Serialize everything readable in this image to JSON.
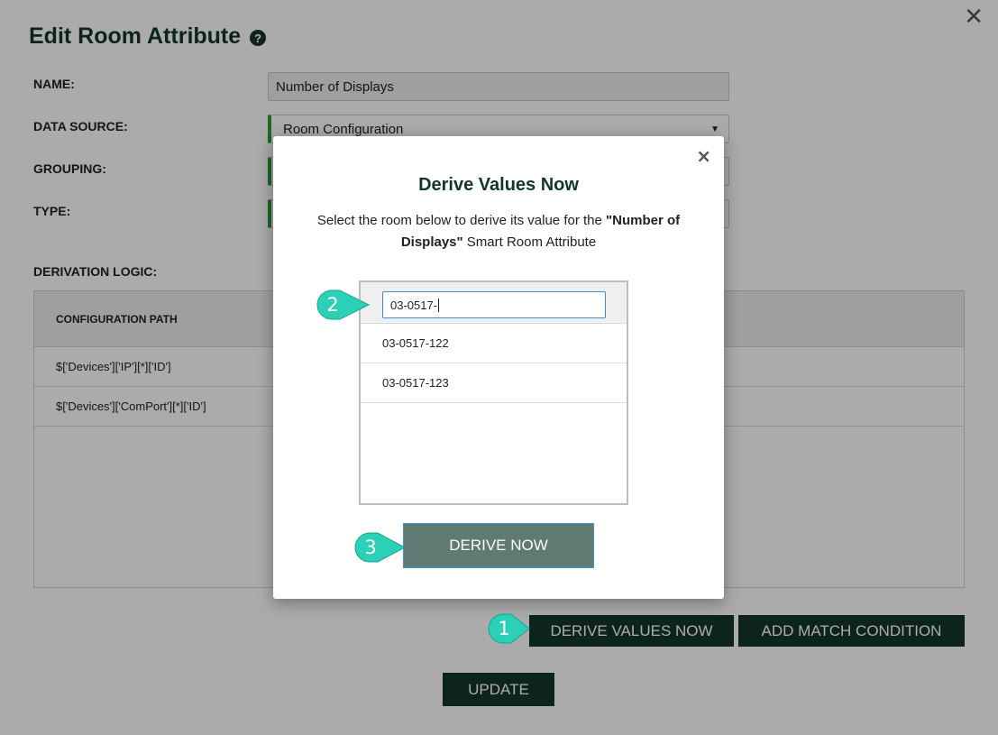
{
  "page": {
    "title": "Edit Room Attribute",
    "help_icon": "question-circle-icon",
    "close_icon": "close-icon",
    "close_glyph": "✕"
  },
  "form": {
    "name_label": "NAME:",
    "name_value": "Number of Displays",
    "data_source_label": "DATA SOURCE:",
    "data_source_value": "Room Configuration",
    "grouping_label": "GROUPING:",
    "type_label": "TYPE:",
    "derivation_label": "DERIVATION LOGIC:"
  },
  "table": {
    "header": "CONFIGURATION PATH",
    "rows": [
      "$['Devices']['IP'][*]['ID']",
      "$['Devices']['ComPort'][*]['ID']"
    ]
  },
  "buttons": {
    "derive_values_now": "DERIVE VALUES NOW",
    "add_match_condition": "ADD MATCH CONDITION",
    "update": "UPDATE"
  },
  "modal": {
    "close_glyph": "×",
    "title": "Derive Values Now",
    "desc_prefix": "Select the room below to derive its value for the ",
    "desc_bold": "\"Number of Displays\"",
    "desc_suffix": " Smart Room Attribute",
    "search_value": "03-0517-",
    "rooms": [
      "03-0517-122",
      "03-0517-123"
    ],
    "derive_button": "DERIVE NOW"
  },
  "steps": [
    "1",
    "2",
    "3"
  ],
  "colors": {
    "brand_dark": "#12362b",
    "accent_green": "#2e9a3a",
    "step_teal": "#2bd1b6",
    "derive_now_bg": "#5f7a73"
  }
}
